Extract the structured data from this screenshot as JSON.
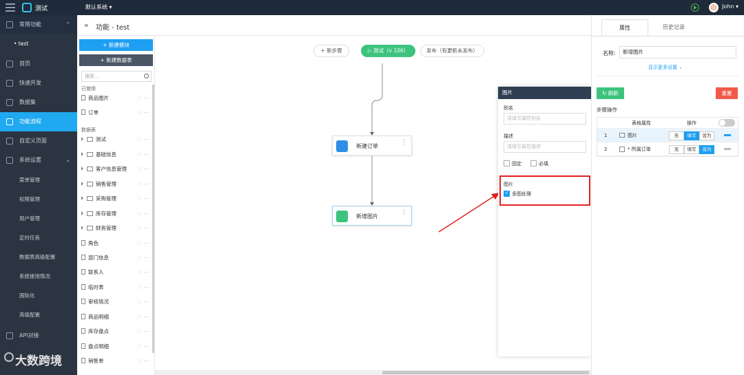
{
  "topbar": {
    "app_name": "测试",
    "system_label": "默认系统 ▾",
    "user": "John ▾"
  },
  "sidebar": {
    "group_label": "常用功能",
    "group_child": "• test",
    "items": [
      "首页",
      "快速开发",
      "数据集",
      "功能流程",
      "自定义页面",
      "系统设置"
    ],
    "sub_items": [
      "菜单管理",
      "权限管理",
      "用户管理",
      "定时任务",
      "数据表高级配置",
      "系统使用情况",
      "国际化",
      "高级配置"
    ],
    "bottom_item": "API对接",
    "watermark": "大数跨境"
  },
  "header": {
    "back": "«",
    "title": "功能 - test"
  },
  "panel": {
    "new_module": "+ 新建模块",
    "new_table": "+ 新建数据表",
    "search_placeholder": "搜索...",
    "used_label": "已使用",
    "used": [
      "商品图片",
      "订单"
    ],
    "tables_label": "数据表",
    "folders": [
      "测试",
      "基础信息",
      "客户信息管理",
      "销售管理",
      "采购管理",
      "库存管理",
      "财务管理"
    ],
    "files": [
      "角色",
      "部门信息",
      "联系人",
      "临时表",
      "审核情况",
      "商品明细",
      "库存盘点",
      "盘点明细",
      "销售单"
    ],
    "acts": "⫶⫶ ···"
  },
  "canvas": {
    "add_step": "+ 新步骤",
    "test_btn": "▷ 测试（v 106）",
    "publish_btn": "发布（有更新未发布）",
    "node1": "新建订单",
    "node2": "新增图片",
    "node_menu": "⋮"
  },
  "prop": {
    "title": "图片",
    "alias_label": "别名",
    "alias_placeholder": "请填写属性别名",
    "desc_label": "描述",
    "desc_placeholder": "请填写属性描述",
    "fixed": "固定",
    "required": "必填",
    "image_label": "图片",
    "multi": "多图处理"
  },
  "right": {
    "tab_props": "属性",
    "tab_history": "历史记录",
    "name_label": "名称:",
    "name_value": "新增图片",
    "more": "显示更多设置 ⌄",
    "refresh": "↻ 刷新",
    "reset": "重置",
    "step_ops": "步骤操作",
    "col_attr": "表格属性",
    "col_op": "操作",
    "rows": [
      {
        "num": "1",
        "name": "图片",
        "ops": [
          "无",
          "填写",
          "设为"
        ],
        "on": 1
      },
      {
        "num": "2",
        "name": "* 所属订单",
        "ops": [
          "无",
          "填写",
          "设为"
        ],
        "on": 2
      }
    ]
  },
  "colors": {
    "accent": "#1e9ff2",
    "green": "#3cc47e",
    "red": "#f05a4a",
    "dark": "#2b3441"
  }
}
